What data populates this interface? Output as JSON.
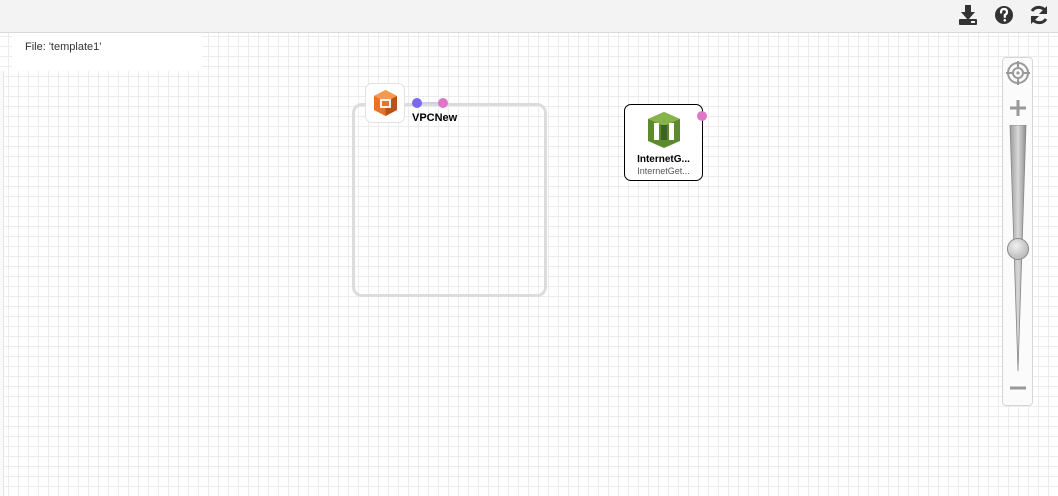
{
  "toolbar": {
    "icons": [
      "download-icon",
      "help-icon",
      "refresh-icon"
    ]
  },
  "file": {
    "label": "File: 'template1'"
  },
  "diagram": {
    "vpc": {
      "label": "VPCNew",
      "icon": "aws-vpc-icon",
      "icon_color": "#e7722a"
    },
    "internet_gateway": {
      "title": "InternetG...",
      "subtitle": "InternetGet...",
      "icon": "internet-gateway-icon",
      "icon_color": "#5e8a2e"
    },
    "port_colors": {
      "in": "#7b68ee",
      "out": "#e076c9"
    }
  },
  "zoom": {
    "level": 0.5
  }
}
